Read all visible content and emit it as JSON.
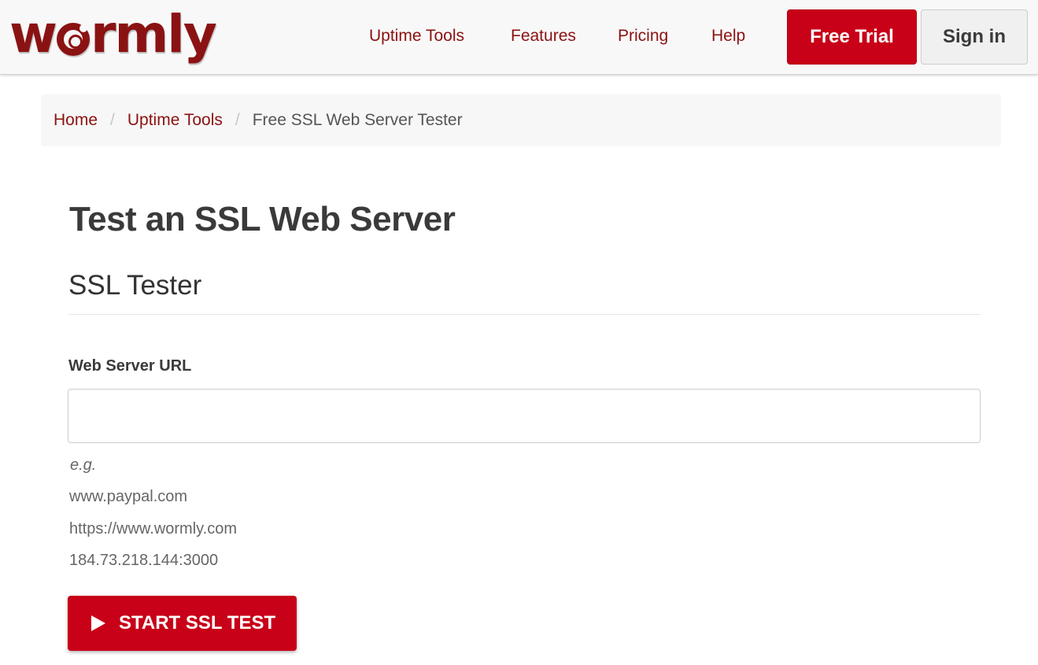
{
  "brand": {
    "logo_text_before": "w",
    "logo_text_after": "rmly",
    "logo_icon": "worm-o-icon",
    "color": "#8b1212"
  },
  "nav": {
    "links": [
      {
        "label": "Uptime Tools"
      },
      {
        "label": "Features"
      },
      {
        "label": "Pricing"
      },
      {
        "label": "Help"
      }
    ],
    "free_trial_label": "Free Trial",
    "sign_in_label": "Sign in"
  },
  "breadcrumb": {
    "home": "Home",
    "section": "Uptime Tools",
    "current": "Free SSL Web Server Tester",
    "separator": "/"
  },
  "main": {
    "page_title": "Test an SSL Web Server",
    "section_title": "SSL Tester",
    "field_label": "Web Server URL",
    "input_value": "",
    "help": {
      "eg": "e.g.",
      "examples": [
        "www.paypal.com",
        "https://www.wormly.com",
        "184.73.218.144:3000"
      ]
    },
    "start_button_label": "START SSL TEST",
    "start_button_icon": "play-icon"
  },
  "colors": {
    "accent": "#c80018",
    "link": "#8b1212",
    "header_bg": "#f8f8f8"
  }
}
